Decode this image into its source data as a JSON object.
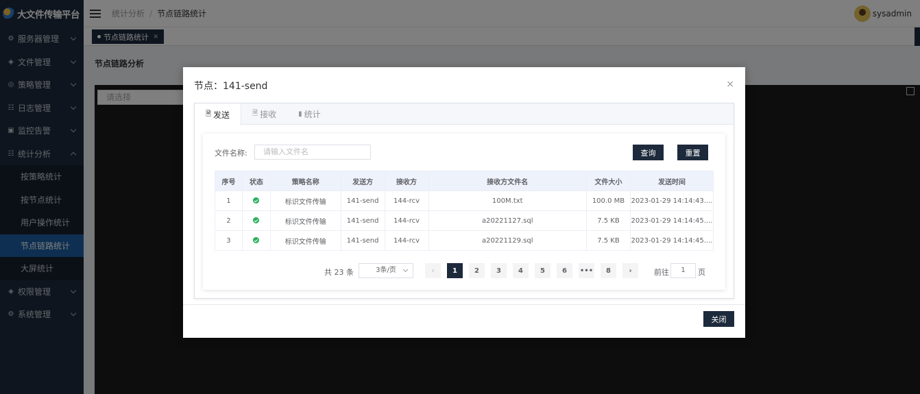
{
  "app": {
    "title": "大文件传输平台"
  },
  "sidebar": {
    "items": [
      {
        "label": "服务器管理",
        "icon": "server-icon"
      },
      {
        "label": "文件管理",
        "icon": "file-icon"
      },
      {
        "label": "策略管理",
        "icon": "policy-icon"
      },
      {
        "label": "日志管理",
        "icon": "log-icon"
      },
      {
        "label": "监控告警",
        "icon": "monitor-icon"
      },
      {
        "label": "统计分析",
        "icon": "stats-icon",
        "expanded": true
      }
    ],
    "subitems": [
      {
        "label": "按策略统计"
      },
      {
        "label": "按节点统计"
      },
      {
        "label": "用户操作统计"
      },
      {
        "label": "节点链路统计",
        "active": true
      },
      {
        "label": "大屏统计"
      }
    ],
    "bottom_items": [
      {
        "label": "权限管理",
        "icon": "permission-icon"
      },
      {
        "label": "系统管理",
        "icon": "settings-icon"
      }
    ]
  },
  "header": {
    "breadcrumb": [
      "统计分析",
      "节点链路统计"
    ],
    "user": "sysadmin"
  },
  "tagsbar": {
    "tag": "节点链路统计",
    "tag_close": "×"
  },
  "content": {
    "title": "节点链路分析",
    "select_placeholder": "请选择"
  },
  "modal": {
    "title": "节点：141-send",
    "close_icon": "×",
    "tabs": [
      {
        "label": "发送",
        "active": true,
        "icon": "document-icon"
      },
      {
        "label": "接收",
        "icon": "document-icon"
      },
      {
        "label": "统计",
        "icon": "bar-chart-icon"
      }
    ],
    "search": {
      "label": "文件名称:",
      "placeholder": "请输入文件名",
      "query_label": "查询",
      "reset_label": "重置"
    },
    "table": {
      "headers": [
        "序号",
        "状态",
        "策略名称",
        "发送方",
        "接收方",
        "接收方文件名",
        "文件大小",
        "发送时间"
      ],
      "rows": [
        {
          "index": "1",
          "status": "success",
          "policy": "标识文件传输",
          "sender": "141-send",
          "receiver": "144-rcv",
          "filename": "100M.txt",
          "size": "100.0 MB",
          "time": "2023-01-29 14:14:43...."
        },
        {
          "index": "2",
          "status": "success",
          "policy": "标识文件传输",
          "sender": "141-send",
          "receiver": "144-rcv",
          "filename": "a20221127.sql",
          "size": "7.5 KB",
          "time": "2023-01-29 14:14:45...."
        },
        {
          "index": "3",
          "status": "success",
          "policy": "标识文件传输",
          "sender": "141-send",
          "receiver": "144-rcv",
          "filename": "a20221129.sql",
          "size": "7.5 KB",
          "time": "2023-01-29 14:14:45...."
        }
      ]
    },
    "pagination": {
      "total": "共 23 条",
      "page_size": "3条/页",
      "pages": [
        "1",
        "2",
        "3",
        "4",
        "5",
        "6",
        "•••",
        "8"
      ],
      "current": "1",
      "prev": "‹",
      "next": "›",
      "goto_label": "前往",
      "goto_value": "1",
      "page_unit": "页"
    },
    "close_label": "关闭"
  },
  "colors": {
    "primary": "#1d2a3c",
    "active_menu": "#1d5fa3",
    "success": "#2ab05d"
  }
}
